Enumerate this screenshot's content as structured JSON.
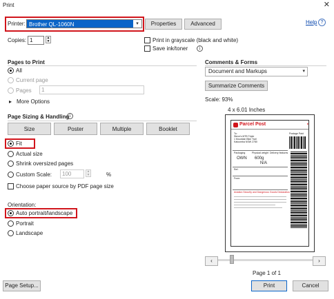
{
  "window": {
    "title": "Print",
    "close_icon": "close-icon"
  },
  "header": {
    "printer_label": "Printer:",
    "printer_value": "Brother QL-1060N",
    "properties_label": "Properties",
    "advanced_label": "Advanced",
    "help_label": "Help",
    "copies_label": "Copies:",
    "copies_value": "1",
    "grayscale_label": "Print in grayscale (black and white)",
    "save_ink_label": "Save ink/toner"
  },
  "pages_to_print": {
    "title": "Pages to Print",
    "all_label": "All",
    "current_page_label": "Current page",
    "pages_label": "Pages",
    "pages_value": "1",
    "more_options_label": "More Options"
  },
  "sizing": {
    "title": "Page Sizing & Handling",
    "buttons": [
      "Size",
      "Poster",
      "Multiple",
      "Booklet"
    ],
    "fit_label": "Fit",
    "actual_size_label": "Actual size",
    "shrink_label": "Shrink oversized pages",
    "custom_scale_label": "Custom Scale:",
    "custom_scale_value": "100",
    "custom_scale_unit": "%",
    "choose_source_label": "Choose paper source by PDF page size",
    "selected": "Fit"
  },
  "orientation": {
    "title": "Orientation:",
    "auto_label": "Auto portrait/landscape",
    "portrait_label": "Portrait",
    "landscape_label": "Landscape",
    "selected": "Auto portrait/landscape"
  },
  "comments_forms": {
    "title": "Comments & Forms",
    "value": "Document and Markups",
    "summarize_label": "Summarize Comments"
  },
  "preview": {
    "scale_label": "Scale:  93%",
    "size_label": "4 x 6.01 Inches",
    "page_label": "Page 1 of 1",
    "label": {
      "title": "Parcel Post",
      "postage_paid": "Postage Paid",
      "to_lines": [
        "To:",
        "Steve's MTB Triple",
        "1 Mountain Bike Trail",
        "Katoomba NSW 2780"
      ],
      "packaging_label": "Packaging",
      "packaging_value": "OWN",
      "weight_label": "Physical weight",
      "weight_value": "600g",
      "delivery_label": "Delivery features",
      "delivery_value": "N/A",
      "ref_label": "Ref:",
      "from_label": "From:",
      "notice": "Aviation Security and Dangerous Goods Declaration"
    }
  },
  "footer": {
    "page_setup_label": "Page Setup...",
    "print_label": "Print",
    "cancel_label": "Cancel"
  },
  "colors": {
    "highlight_red": "#d1141b",
    "select_blue": "#0a64c8"
  }
}
